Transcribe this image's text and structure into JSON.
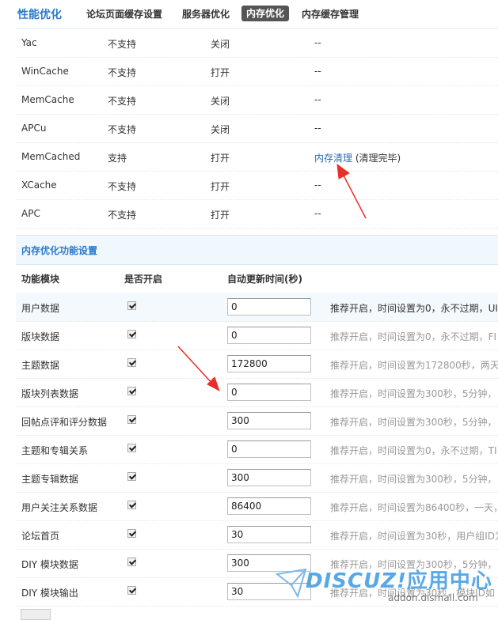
{
  "nav": {
    "title": "性能优化",
    "tabs": [
      {
        "label": "论坛页面缓存设置"
      },
      {
        "label": "服务器优化"
      },
      {
        "label": "内存优化"
      },
      {
        "label": "内存缓存管理"
      }
    ]
  },
  "cache_rows": [
    {
      "name": "Yac",
      "support": "不支持",
      "status": "关闭",
      "action": "--"
    },
    {
      "name": "WinCache",
      "support": "不支持",
      "status": "打开",
      "action": "--"
    },
    {
      "name": "MemCache",
      "support": "不支持",
      "status": "关闭",
      "action": "--"
    },
    {
      "name": "APCu",
      "support": "不支持",
      "status": "关闭",
      "action": "--"
    },
    {
      "name": "MemCached",
      "support": "支持",
      "status": "打开",
      "action_link": "内存清理",
      "action_note": "(清理完毕)"
    },
    {
      "name": "XCache",
      "support": "不支持",
      "status": "打开",
      "action": "--"
    },
    {
      "name": "APC",
      "support": "不支持",
      "status": "打开",
      "action": "--"
    }
  ],
  "section": {
    "title": "内存优化功能设置"
  },
  "columns": {
    "module": "功能模块",
    "enabled": "是否开启",
    "ttl": "自动更新时间(秒)"
  },
  "modules": [
    {
      "label": "用户数据",
      "enabled": true,
      "value": "0",
      "tip": "推荐开启，时间设置为0，永不过期，UI"
    },
    {
      "label": "版块数据",
      "enabled": true,
      "value": "0",
      "tip": "推荐开启，时间设置为0，永不过期，FI"
    },
    {
      "label": "主题数据",
      "enabled": true,
      "value": "172800",
      "tip": "推荐开启，时间设置为172800秒，两天"
    },
    {
      "label": "版块列表数据",
      "enabled": true,
      "value": "0",
      "tip": "推荐开启，时间设置为300秒，5分钟，"
    },
    {
      "label": "回帖点评和评分数据",
      "enabled": true,
      "value": "300",
      "tip": "推荐开启，时间设置为300秒，5分钟，"
    },
    {
      "label": "主题和专辑关系",
      "enabled": true,
      "value": "0",
      "tip": "推荐开启，时间设置为0，永不过期，TI"
    },
    {
      "label": "主题专辑数据",
      "enabled": true,
      "value": "300",
      "tip": "推荐开启，时间设置为300秒，5分钟，"
    },
    {
      "label": "用户关注关系数据",
      "enabled": true,
      "value": "86400",
      "tip": "推荐开启，时间设置为86400秒，一天，"
    },
    {
      "label": "论坛首页",
      "enabled": true,
      "value": "30",
      "tip": "推荐开启，时间设置为30秒，用户组ID为"
    },
    {
      "label": "DIY 模块数据",
      "enabled": true,
      "value": "300",
      "tip": "推荐开启，时间设置为300秒，5分钟，"
    },
    {
      "label": "DIY 模块输出",
      "enabled": true,
      "value": "30",
      "tip": "推荐开启，时间设置为30秒，模块ID如"
    }
  ],
  "watermark": {
    "brand": "DISCUZ!",
    "brand_cn": "应用中心",
    "url": "addon.dismall.com"
  },
  "colors": {
    "accent": "#2b7acb",
    "link": "#2b6db3",
    "arrow": "#e8302a",
    "active_tab_bg": "#555555"
  }
}
